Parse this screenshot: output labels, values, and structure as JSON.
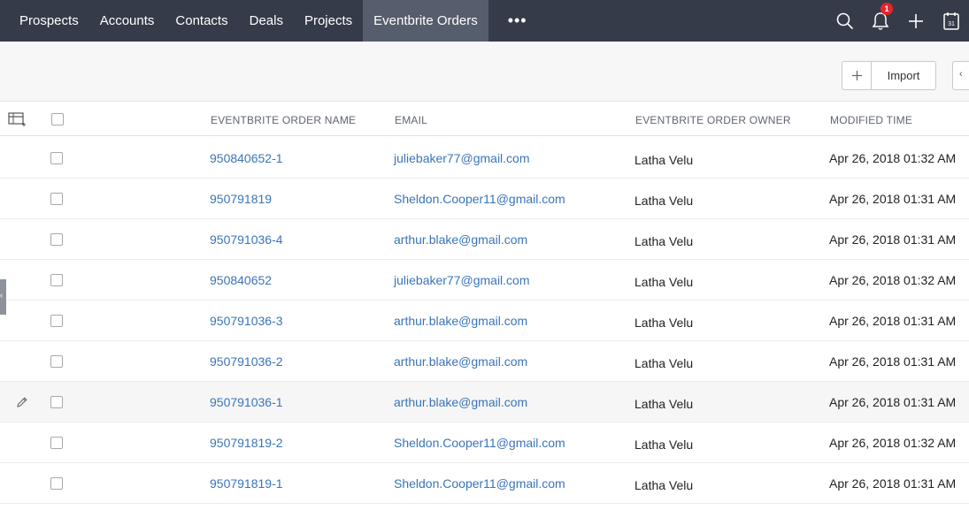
{
  "nav": {
    "tabs": [
      {
        "label": "Prospects"
      },
      {
        "label": "Accounts"
      },
      {
        "label": "Contacts"
      },
      {
        "label": "Deals"
      },
      {
        "label": "Projects"
      },
      {
        "label": "Eventbrite Orders",
        "active": true
      }
    ],
    "more": "•••",
    "notifications_count": "1",
    "calendar_day": "31"
  },
  "toolbar": {
    "plus": "+",
    "import_label": "Import",
    "edge_glyph": "‹"
  },
  "table": {
    "columns": [
      "EVENTBRITE ORDER NAME",
      "EMAIL",
      "EVENTBRITE ORDER OWNER",
      "MODIFIED TIME"
    ],
    "rows": [
      {
        "name": "950840652-1",
        "email": "juliebaker77@gmail.com",
        "owner": "Latha Velu",
        "time": "Apr 26, 2018 01:32 AM"
      },
      {
        "name": "950791819",
        "email": "Sheldon.Cooper11@gmail.com",
        "owner": "Latha Velu",
        "time": "Apr 26, 2018 01:31 AM"
      },
      {
        "name": "950791036-4",
        "email": "arthur.blake@gmail.com",
        "owner": "Latha Velu",
        "time": "Apr 26, 2018 01:31 AM"
      },
      {
        "name": "950840652",
        "email": "juliebaker77@gmail.com",
        "owner": "Latha Velu",
        "time": "Apr 26, 2018 01:32 AM"
      },
      {
        "name": "950791036-3",
        "email": "arthur.blake@gmail.com",
        "owner": "Latha Velu",
        "time": "Apr 26, 2018 01:31 AM"
      },
      {
        "name": "950791036-2",
        "email": "arthur.blake@gmail.com",
        "owner": "Latha Velu",
        "time": "Apr 26, 2018 01:31 AM"
      },
      {
        "name": "950791036-1",
        "email": "arthur.blake@gmail.com",
        "owner": "Latha Velu",
        "time": "Apr 26, 2018 01:31 AM",
        "hovered": true
      },
      {
        "name": "950791819-2",
        "email": "Sheldon.Cooper11@gmail.com",
        "owner": "Latha Velu",
        "time": "Apr 26, 2018 01:32 AM"
      },
      {
        "name": "950791819-1",
        "email": "Sheldon.Cooper11@gmail.com",
        "owner": "Latha Velu",
        "time": "Apr 26, 2018 01:31 AM"
      }
    ]
  },
  "side_handle_glyph": "‹",
  "colors": {
    "nav_bg": "#353b49",
    "nav_active": "#565d6c",
    "link": "#3a74b8",
    "badge": "#e5252a"
  },
  "icons": [
    "search-icon",
    "bell-icon",
    "plus-icon",
    "calendar-icon",
    "column-settings-icon",
    "pencil-icon"
  ]
}
